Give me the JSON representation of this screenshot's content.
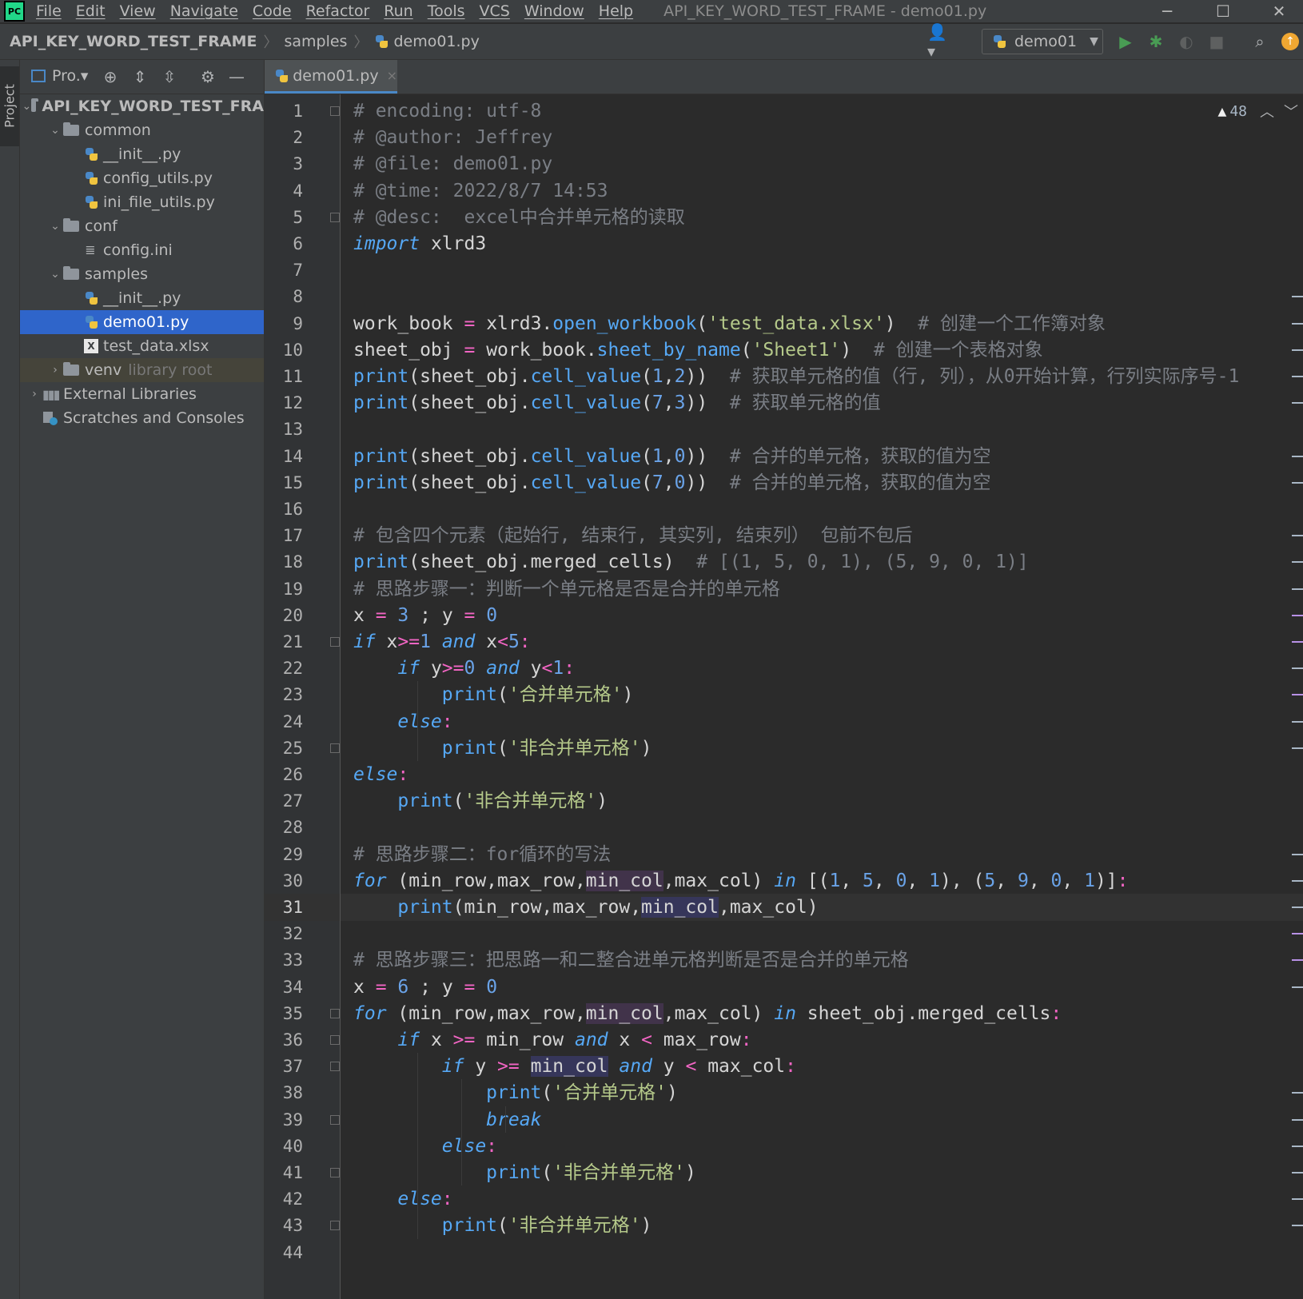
{
  "menubar": {
    "items": [
      "File",
      "Edit",
      "View",
      "Navigate",
      "Code",
      "Refactor",
      "Run",
      "Tools",
      "VCS",
      "Window",
      "Help"
    ],
    "window_title": "API_KEY_WORD_TEST_FRAME - demo01.py",
    "logo_text": "PC"
  },
  "navbar": {
    "crumbs": [
      "API_KEY_WORD_TEST_FRAME",
      "samples",
      "demo01.py"
    ],
    "run_config": "demo01"
  },
  "left_stripe": {
    "project_label": "Project"
  },
  "project_toolbar": {
    "view_label": "Pro.▾"
  },
  "tree": [
    {
      "label": "API_KEY_WORD_TEST_FRA",
      "type": "folder",
      "level": 0,
      "expanded": true,
      "bold": true
    },
    {
      "label": "common",
      "type": "folder",
      "level": 1,
      "expanded": true
    },
    {
      "label": "__init__.py",
      "type": "py",
      "level": 2
    },
    {
      "label": "config_utils.py",
      "type": "py",
      "level": 2
    },
    {
      "label": "ini_file_utils.py",
      "type": "py",
      "level": 2
    },
    {
      "label": "conf",
      "type": "folder",
      "level": 1,
      "expanded": true
    },
    {
      "label": "config.ini",
      "type": "ini",
      "level": 2
    },
    {
      "label": "samples",
      "type": "folder",
      "level": 1,
      "expanded": true
    },
    {
      "label": "__init__.py",
      "type": "py",
      "level": 2
    },
    {
      "label": "demo01.py",
      "type": "py",
      "level": 2,
      "selected": true
    },
    {
      "label": "test_data.xlsx",
      "type": "xlsx",
      "level": 2
    },
    {
      "label": "venv",
      "type": "folder",
      "level": 1,
      "expanded": false,
      "extra": "library root"
    },
    {
      "label": "External Libraries",
      "type": "lib",
      "level": 0,
      "expanded": false
    },
    {
      "label": "Scratches and Consoles",
      "type": "scratch",
      "level": 0
    }
  ],
  "editor": {
    "tab_label": "demo01.py",
    "tab_close": "×",
    "warnings_count": "48",
    "current_line": 31,
    "lines": [
      [
        [
          "cm",
          "# encoding: utf-8"
        ]
      ],
      [
        [
          "cm",
          "# @author: Jeffrey"
        ]
      ],
      [
        [
          "cm",
          "# @file: demo01.py"
        ]
      ],
      [
        [
          "cm",
          "# @time: 2022/8/7 14:53"
        ]
      ],
      [
        [
          "cm",
          "# @desc:  excel中合并单元格的读取"
        ]
      ],
      [
        [
          "kw",
          "import"
        ],
        [
          "id",
          " xlrd3"
        ]
      ],
      [],
      [],
      [
        [
          "id",
          "work_book "
        ],
        [
          "op",
          "="
        ],
        [
          "id",
          " xlrd3."
        ],
        [
          "fn",
          "open_workbook"
        ],
        [
          "id",
          "("
        ],
        [
          "str",
          "'test_data.xlsx'"
        ],
        [
          "id",
          ")  "
        ],
        [
          "cm",
          "# 创建一个工作簿对象"
        ]
      ],
      [
        [
          "id",
          "sheet_obj "
        ],
        [
          "op",
          "="
        ],
        [
          "id",
          " work_book."
        ],
        [
          "fn",
          "sheet_by_name"
        ],
        [
          "id",
          "("
        ],
        [
          "str",
          "'Sheet1'"
        ],
        [
          "id",
          ")  "
        ],
        [
          "cm",
          "# 创建一个表格对象"
        ]
      ],
      [
        [
          "fn",
          "print"
        ],
        [
          "id",
          "(sheet_obj."
        ],
        [
          "fn",
          "cell_value"
        ],
        [
          "id",
          "("
        ],
        [
          "num",
          "1"
        ],
        [
          "id",
          ","
        ],
        [
          "num",
          "2"
        ],
        [
          "id",
          "))  "
        ],
        [
          "cm",
          "# 获取单元格的值（行, 列），从0开始计算，行列实际序号-1"
        ]
      ],
      [
        [
          "fn",
          "print"
        ],
        [
          "id",
          "(sheet_obj."
        ],
        [
          "fn",
          "cell_value"
        ],
        [
          "id",
          "("
        ],
        [
          "num",
          "7"
        ],
        [
          "id",
          ","
        ],
        [
          "num",
          "3"
        ],
        [
          "id",
          "))  "
        ],
        [
          "cm",
          "# 获取单元格的值"
        ]
      ],
      [],
      [
        [
          "fn",
          "print"
        ],
        [
          "id",
          "(sheet_obj."
        ],
        [
          "fn",
          "cell_value"
        ],
        [
          "id",
          "("
        ],
        [
          "num",
          "1"
        ],
        [
          "id",
          ","
        ],
        [
          "num",
          "0"
        ],
        [
          "id",
          "))  "
        ],
        [
          "cm",
          "# 合并的单元格，获取的值为空"
        ]
      ],
      [
        [
          "fn",
          "print"
        ],
        [
          "id",
          "(sheet_obj."
        ],
        [
          "fn",
          "cell_value"
        ],
        [
          "id",
          "("
        ],
        [
          "num",
          "7"
        ],
        [
          "id",
          ","
        ],
        [
          "num",
          "0"
        ],
        [
          "id",
          "))  "
        ],
        [
          "cm",
          "# 合并的单元格，获取的值为空"
        ]
      ],
      [],
      [
        [
          "cm",
          "# 包含四个元素（起始行, 结束行, 其实列, 结束列） 包前不包后"
        ]
      ],
      [
        [
          "fn",
          "print"
        ],
        [
          "id",
          "(sheet_obj.merged_cells)  "
        ],
        [
          "cm",
          "# [(1, 5, 0, 1), (5, 9, 0, 1)]"
        ]
      ],
      [
        [
          "cm",
          "# 思路步骤一：判断一个单元格是否是合并的单元格"
        ]
      ],
      [
        [
          "id",
          "x "
        ],
        [
          "op",
          "="
        ],
        [
          "id",
          " "
        ],
        [
          "num",
          "3"
        ],
        [
          "id",
          " ; y "
        ],
        [
          "op",
          "="
        ],
        [
          "id",
          " "
        ],
        [
          "num",
          "0"
        ]
      ],
      [
        [
          "kw",
          "if"
        ],
        [
          "id",
          " x"
        ],
        [
          "op",
          ">="
        ],
        [
          "num",
          "1"
        ],
        [
          "id",
          " "
        ],
        [
          "kw",
          "and"
        ],
        [
          "id",
          " x"
        ],
        [
          "op",
          "<"
        ],
        [
          "num",
          "5"
        ],
        [
          "op",
          ":"
        ]
      ],
      [
        [
          "id",
          "    "
        ],
        [
          "kw",
          "if"
        ],
        [
          "id",
          " y"
        ],
        [
          "op",
          ">="
        ],
        [
          "num",
          "0"
        ],
        [
          "id",
          " "
        ],
        [
          "kw",
          "and"
        ],
        [
          "id",
          " y"
        ],
        [
          "op",
          "<"
        ],
        [
          "num",
          "1"
        ],
        [
          "op",
          ":"
        ]
      ],
      [
        [
          "id",
          "        "
        ],
        [
          "fn",
          "print"
        ],
        [
          "id",
          "("
        ],
        [
          "str",
          "'合并单元格'"
        ],
        [
          "id",
          ")"
        ]
      ],
      [
        [
          "id",
          "    "
        ],
        [
          "kw",
          "else"
        ],
        [
          "op",
          ":"
        ]
      ],
      [
        [
          "id",
          "        "
        ],
        [
          "fn",
          "print"
        ],
        [
          "id",
          "("
        ],
        [
          "str",
          "'非合并单元格'"
        ],
        [
          "id",
          ")"
        ]
      ],
      [
        [
          "kw",
          "else"
        ],
        [
          "op",
          ":"
        ]
      ],
      [
        [
          "id",
          "    "
        ],
        [
          "fn",
          "print"
        ],
        [
          "id",
          "("
        ],
        [
          "str",
          "'非合并单元格'"
        ],
        [
          "id",
          ")"
        ]
      ],
      [],
      [
        [
          "cm",
          "# 思路步骤二：for循环的写法"
        ]
      ],
      [
        [
          "kw",
          "for"
        ],
        [
          "id",
          " (min_row,max_row,"
        ],
        [
          "hl",
          "min_col"
        ],
        [
          "id",
          ",max_col) "
        ],
        [
          "kw",
          "in"
        ],
        [
          "id",
          " [("
        ],
        [
          "num",
          "1"
        ],
        [
          "id",
          ", "
        ],
        [
          "num",
          "5"
        ],
        [
          "id",
          ", "
        ],
        [
          "num",
          "0"
        ],
        [
          "id",
          ", "
        ],
        [
          "num",
          "1"
        ],
        [
          "id",
          "), ("
        ],
        [
          "num",
          "5"
        ],
        [
          "id",
          ", "
        ],
        [
          "num",
          "9"
        ],
        [
          "id",
          ", "
        ],
        [
          "num",
          "0"
        ],
        [
          "id",
          ", "
        ],
        [
          "num",
          "1"
        ],
        [
          "id",
          ")]"
        ],
        [
          "op",
          ":"
        ]
      ],
      [
        [
          "id",
          "    "
        ],
        [
          "fn",
          "print"
        ],
        [
          "id",
          "(min_row,max_row,"
        ],
        [
          "hl2",
          "min_col"
        ],
        [
          "id",
          ",max_col)"
        ]
      ],
      [],
      [
        [
          "cm",
          "# 思路步骤三：把思路一和二整合进单元格判断是否是合并的单元格"
        ]
      ],
      [
        [
          "id",
          "x "
        ],
        [
          "op",
          "="
        ],
        [
          "id",
          " "
        ],
        [
          "num",
          "6"
        ],
        [
          "id",
          " ; y "
        ],
        [
          "op",
          "="
        ],
        [
          "id",
          " "
        ],
        [
          "num",
          "0"
        ]
      ],
      [
        [
          "kw",
          "for"
        ],
        [
          "id",
          " (min_row,max_row,"
        ],
        [
          "hl",
          "min_col"
        ],
        [
          "id",
          ",max_col) "
        ],
        [
          "kw",
          "in"
        ],
        [
          "id",
          " sheet_obj.merged_cells"
        ],
        [
          "op",
          ":"
        ]
      ],
      [
        [
          "id",
          "    "
        ],
        [
          "kw",
          "if"
        ],
        [
          "id",
          " x "
        ],
        [
          "op",
          ">="
        ],
        [
          "id",
          " min_row "
        ],
        [
          "kw",
          "and"
        ],
        [
          "id",
          " x "
        ],
        [
          "op",
          "<"
        ],
        [
          "id",
          " max_row"
        ],
        [
          "op",
          ":"
        ]
      ],
      [
        [
          "id",
          "        "
        ],
        [
          "kw",
          "if"
        ],
        [
          "id",
          " y "
        ],
        [
          "op",
          ">="
        ],
        [
          "id",
          " "
        ],
        [
          "hl2",
          "min_col"
        ],
        [
          "id",
          " "
        ],
        [
          "kw",
          "and"
        ],
        [
          "id",
          " y "
        ],
        [
          "op",
          "<"
        ],
        [
          "id",
          " max_col"
        ],
        [
          "op",
          ":"
        ]
      ],
      [
        [
          "id",
          "            "
        ],
        [
          "fn",
          "print"
        ],
        [
          "id",
          "("
        ],
        [
          "str",
          "'合并单元格'"
        ],
        [
          "id",
          ")"
        ]
      ],
      [
        [
          "id",
          "            "
        ],
        [
          "kw",
          "break"
        ]
      ],
      [
        [
          "id",
          "        "
        ],
        [
          "kw",
          "else"
        ],
        [
          "op",
          ":"
        ]
      ],
      [
        [
          "id",
          "            "
        ],
        [
          "fn",
          "print"
        ],
        [
          "id",
          "("
        ],
        [
          "str",
          "'非合并单元格'"
        ],
        [
          "id",
          ")"
        ]
      ],
      [
        [
          "id",
          "    "
        ],
        [
          "kw",
          "else"
        ],
        [
          "op",
          ":"
        ]
      ],
      [
        [
          "id",
          "        "
        ],
        [
          "fn",
          "print"
        ],
        [
          "id",
          "("
        ],
        [
          "str",
          "'非合并单元格'"
        ],
        [
          "id",
          ")"
        ]
      ],
      []
    ]
  },
  "colors": {
    "accent": "#2f65ca",
    "run_green": "#499c54",
    "warning_orange": "#f0a732"
  }
}
